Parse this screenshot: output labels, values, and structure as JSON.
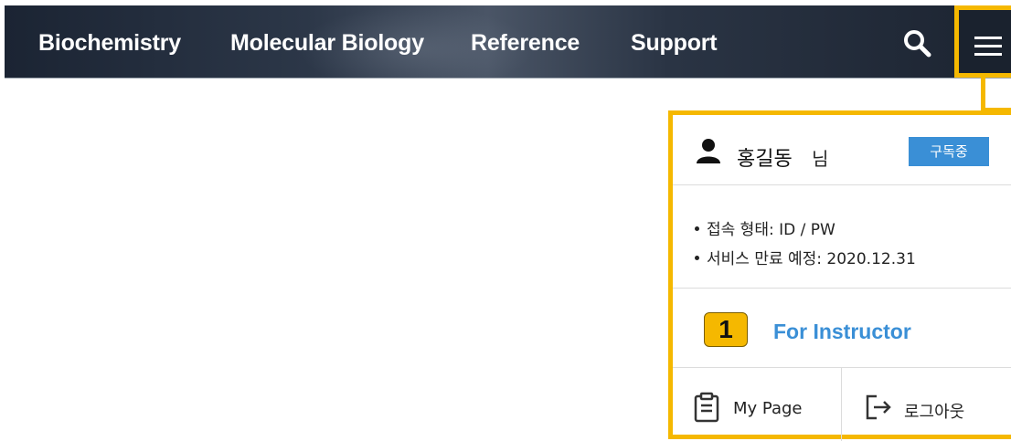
{
  "nav": {
    "items": [
      "Biochemistry",
      "Molecular Biology",
      "Reference",
      "Support"
    ],
    "search_icon": "search-icon",
    "menu_icon": "hamburger-menu-icon"
  },
  "panel": {
    "user_icon": "user-icon",
    "user_name": "홍길동",
    "user_suffix": "님",
    "badge": "구독중",
    "info": [
      "접속 형태: ID / PW",
      "서비스 만료 예정: 2020.12.31"
    ],
    "step_number": "1",
    "instructor_link": "For Instructor",
    "my_page_label": "My Page",
    "my_page_icon": "clipboard-icon",
    "logout_label": "로그아웃",
    "logout_icon": "logout-icon"
  },
  "colors": {
    "highlight": "#f5b800",
    "accent_blue": "#3a8fd6",
    "navbar_dark": "#1b2433"
  }
}
